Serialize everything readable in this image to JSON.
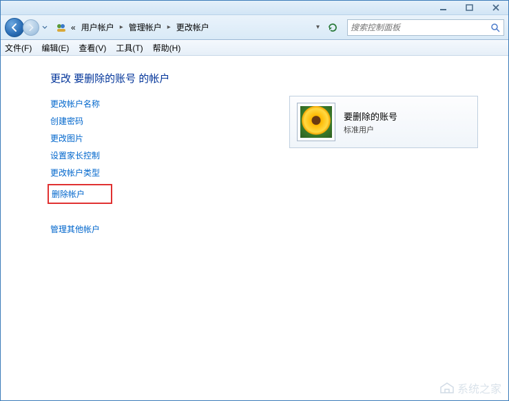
{
  "titlebar": {},
  "breadcrumb": {
    "prefix": "«",
    "seg1": "用户帐户",
    "seg2": "管理帐户",
    "seg3": "更改帐户"
  },
  "search": {
    "placeholder": "搜索控制面板"
  },
  "menu": {
    "file": "文件(F)",
    "edit": "编辑(E)",
    "view": "查看(V)",
    "tools": "工具(T)",
    "help": "帮助(H)"
  },
  "page": {
    "title": "更改 要删除的账号 的帐户"
  },
  "actions": {
    "rename": "更改帐户名称",
    "create_password": "创建密码",
    "change_picture": "更改图片",
    "parental": "设置家长控制",
    "change_type": "更改帐户类型",
    "delete": "删除帐户",
    "manage_other": "管理其他帐户"
  },
  "account": {
    "name": "要删除的账号",
    "type": "标准用户"
  },
  "watermark": "系统之家"
}
